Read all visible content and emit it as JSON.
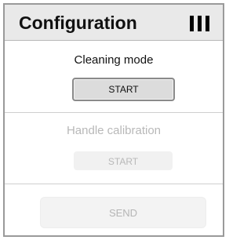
{
  "header": {
    "title": "Configuration",
    "icon": "signal-bars-icon"
  },
  "cleaning": {
    "label": "Cleaning mode",
    "button": "START"
  },
  "calibration": {
    "label": "Handle calibration",
    "button": "START"
  },
  "send": {
    "label": "SEND"
  },
  "colors": {
    "header_bg": "#e9e9e9",
    "border": "#9a9a9a",
    "disabled_text": "#b8b8b8"
  }
}
